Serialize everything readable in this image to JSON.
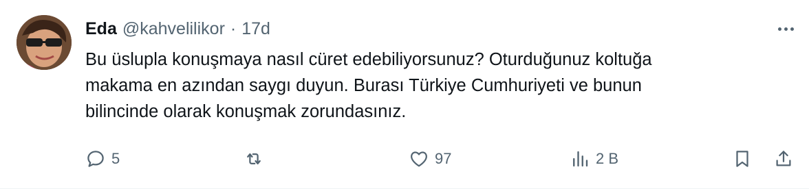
{
  "tweet": {
    "author": {
      "name": "Eda",
      "handle": "@kahvelilikor",
      "separator": "·",
      "time": "17d"
    },
    "text": "Bu üslupla konuşmaya nasıl cüret edebiliyorsunuz? Oturduğunuz koltuğa\nmakama en azından saygı duyun. Burası Türkiye Cumhuriyeti ve bunun\nbilincinde olarak konuşmak zorundasınız.",
    "actions": {
      "replies": "5",
      "retweets": "",
      "likes": "97",
      "views": "2 B"
    },
    "icons": {
      "reply": "reply-icon",
      "retweet": "retweet-icon",
      "like": "heart-icon",
      "views": "analytics-icon",
      "bookmark": "bookmark-icon",
      "share": "share-icon",
      "more": "more-icon"
    },
    "colors": {
      "text": "#0f1419",
      "secondary": "#536471"
    }
  }
}
